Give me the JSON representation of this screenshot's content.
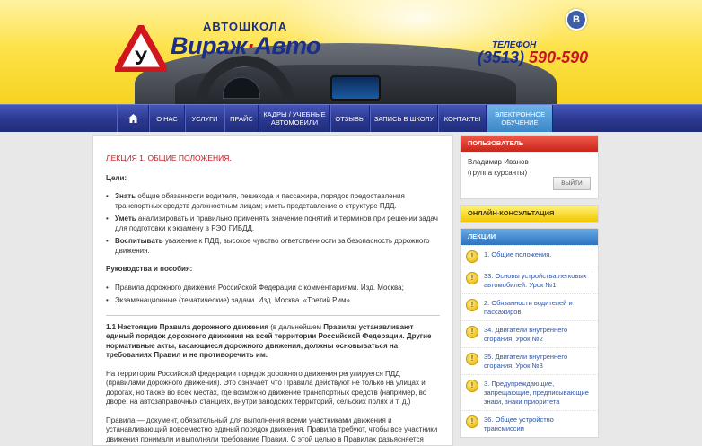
{
  "header": {
    "school_label": "АВТОШКОЛА",
    "school_name_part1": "Вираж",
    "school_name_sep": "·",
    "school_name_part2": "Авто",
    "logo_letter": "У",
    "phone_label": "ТЕЛЕФОН",
    "phone_code": "(3513)",
    "phone_number": "590-590",
    "social_letter": "В"
  },
  "nav": {
    "items": [
      {
        "label": "О НАС"
      },
      {
        "label": "УСЛУГИ"
      },
      {
        "label": "ПРАЙС"
      },
      {
        "label": "КАДРЫ / УЧЕБНЫЕ АВТОМОБИЛИ"
      },
      {
        "label": "ОТЗЫВЫ"
      },
      {
        "label": "ЗАПИСЬ В ШКОЛУ"
      },
      {
        "label": "КОНТАКТЫ"
      },
      {
        "label": "ЭЛЕКТРОННОЕ ОБУЧЕНИЕ"
      }
    ]
  },
  "content": {
    "lecture_title": "ЛЕКЦИЯ 1. ОБЩИЕ ПОЛОЖЕНИЯ.",
    "goals_heading": "Цели:",
    "goals": [
      {
        "bold": "Знать",
        "text": " общие обязанности водителя, пешехода и пассажира, порядок предоставления транспортных средств должностным лицам; иметь представление о структуре ПДД."
      },
      {
        "bold": "Уметь",
        "text": " анализировать и правильно применять значение понятий и терминов при решении задач для подготовки к экзамену в РЭО ГИБДД."
      },
      {
        "bold": "Воспитывать",
        "text": " уважение к ПДД, высокое чувство ответственности за безопасность дорожного движения."
      }
    ],
    "manuals_heading": "Руководства и пособия:",
    "manuals": [
      "Правила дорожного движения Российской Федерации с комментариями. Изд. Москва;",
      "Экзаменационные (тематические) задачи. Изд. Москва. «Третий Рим»."
    ],
    "p1_bold1": "1.1 Настоящие Правила дорожного движения",
    "p1_normal": " (в дальнейшем ",
    "p1_bold2": "Правила",
    "p1_normal2": ") ",
    "p1_bold3": "устанавливают единый порядок дорожного движения на всей территории Российской Федерации. Другие нормативные акты, касающиеся дорожного движения, должны основываться на требованиях Правил и не противоречить им.",
    "p2": "На территории Российской федерации порядок дорожного движения регулируется ПДД (правилами дорожного движения). Это означает, что Правила действуют не только на улицах и дорогах, но также во всех местах, где возможно движение транспортных средств (например, во дворе, на автозаправочных станциях, внутри заводских территорий, сельских полях и т. д.)",
    "p3": "Правила — документ, обязательный для выполнения всеми участниками движения и устанавливающий повсеместно единый порядок движения. Правила требуют, чтобы все участники движения понимали и выполняли требование Правил. С этой целью в Правилах разъясняется значение"
  },
  "sidebar": {
    "user_head": "ПОЛЬЗОВАТЕЛЬ",
    "user_name": "Владимир Иванов",
    "user_group": "(группа курсанты)",
    "logout": "ВЫЙТИ",
    "consult_head": "ОНЛАЙН-КОНСУЛЬТАЦИЯ",
    "lectures_head": "ЛЕКЦИИ",
    "lectures": [
      "1. Общие положения.",
      "33. Основы устройства легковых автомобилей. Урок №1",
      "2. Обязанности водителей и пассажиров.",
      "34. Двигатели внутреннего сгорания. Урок №2",
      "35. Двигатели внутреннего сгорания. Урок №3",
      "3. Предупреждающие, запрещающие, предписывающие знаки, знаки приоритета",
      "36. Общее устройство трансмиссии"
    ]
  }
}
